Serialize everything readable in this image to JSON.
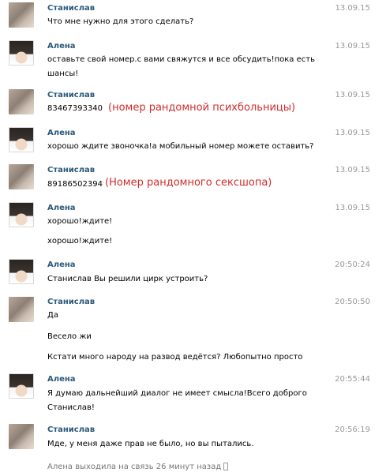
{
  "messages": [
    {
      "author": "Станислав",
      "date": "13.09.15",
      "lines": [
        "Что мне нужно для этого сделать?"
      ]
    },
    {
      "author": "Алена",
      "date": "13.09.15",
      "lines": [
        "оставьте свой номер.с вами свяжутся и все обсудить!пока есть",
        "шансы!"
      ]
    },
    {
      "author": "Станислав",
      "date": "13.09.15",
      "lines": [
        "83467393340"
      ],
      "annotation": "(номер рандомной психбольницы)"
    },
    {
      "author": "Алена",
      "date": "13.09.15",
      "lines": [
        "хорошо ждите звоночка!а мобильный номер можете оставить?"
      ]
    },
    {
      "author": "Станислав",
      "date": "13.09.15",
      "lines": [
        "89186502394"
      ],
      "annotation": "(Номер рандомного сексшопа)"
    },
    {
      "author": "Алена",
      "date": "13.09.15",
      "lines": [
        "хорошо!ждите!",
        "хорошо!ждите!"
      ]
    },
    {
      "author": "Алена",
      "date": "20:50:24",
      "lines": [
        "Станислав Вы решили цирк устроить?"
      ]
    },
    {
      "author": "Станислав",
      "date": "20:50:50",
      "lines": [
        "Да",
        "Весело жи",
        "Кстати много народу на развод ведётся? Любопытно просто"
      ]
    },
    {
      "author": "Алена",
      "date": "20:55:44",
      "lines": [
        "Я думаю дальнейший диалог не имеет смысла!Всего доброго",
        "Станислав!"
      ]
    },
    {
      "author": "Станислав",
      "date": "20:56:19",
      "lines": [
        "Мде, у меня даже прав не было, но вы пытались."
      ]
    }
  ],
  "status": "Алена выходила на связь 26 минут назад",
  "colors": {
    "name": "#2b587a",
    "annotation": "#d22b2b",
    "date": "#999999"
  },
  "icons": {
    "status": "mobile-phone-icon"
  }
}
